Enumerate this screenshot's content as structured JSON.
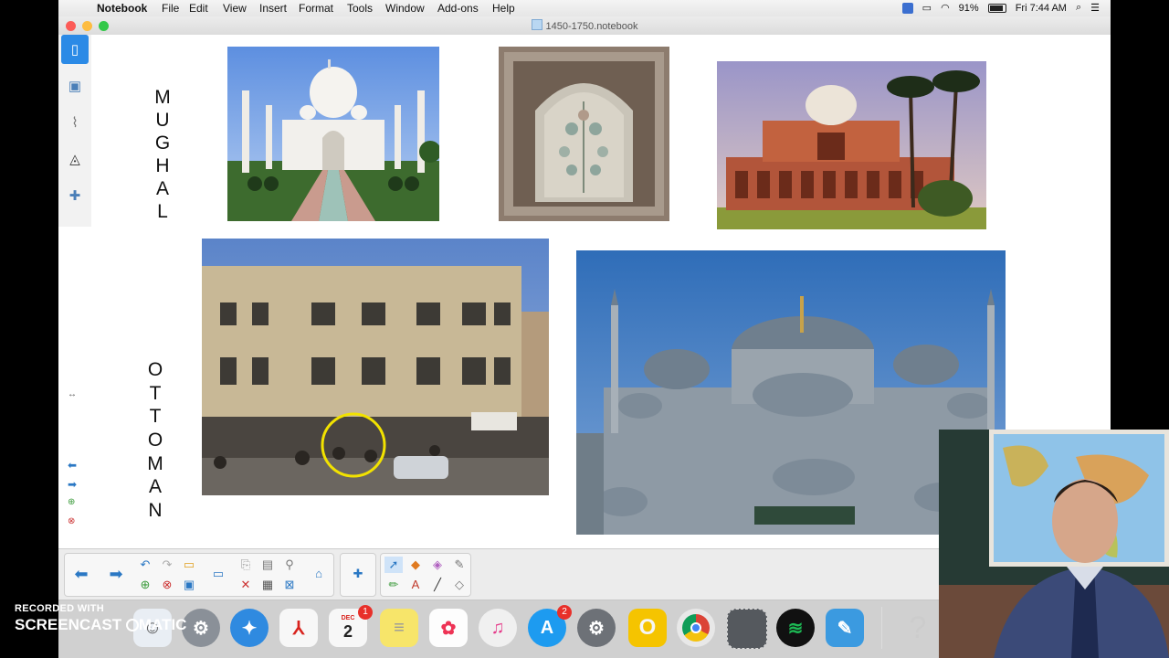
{
  "menubar": {
    "app_name": "Notebook",
    "menus": [
      "File",
      "Edit",
      "View",
      "Insert",
      "Format",
      "Tools",
      "Window",
      "Add-ons",
      "Help"
    ],
    "battery": "91%",
    "clock": "Fri 7:44 AM"
  },
  "window": {
    "title": "1450-1750.notebook"
  },
  "side_tabs": [
    "page-sorter-icon",
    "gallery-icon",
    "attachments-icon",
    "properties-icon",
    "add-ons-icon"
  ],
  "canvas": {
    "mughal_letters": [
      "M",
      "U",
      "G",
      "H",
      "A",
      "L"
    ],
    "ottoman_letters": [
      "O",
      "T",
      "T",
      "O",
      "M",
      "A",
      "N"
    ],
    "images": [
      {
        "name": "taj-mahal-photo",
        "description_icon": "taj-mahal"
      },
      {
        "name": "carved-panel-photo",
        "description_icon": "carved-panel"
      },
      {
        "name": "humayun-tomb-photo",
        "description_icon": "red-sandstone-tomb"
      },
      {
        "name": "ottoman-building-photo",
        "description_icon": "street-building"
      },
      {
        "name": "blue-mosque-photo",
        "description_icon": "mosque"
      }
    ]
  },
  "dock": {
    "calendar_month": "DEC",
    "calendar_day": "2",
    "calendar_badge": "1",
    "appstore_badge": "2"
  },
  "watermark": {
    "line1": "RECORDED WITH",
    "line2a": "SCREENCAST",
    "line2b": "MATIC"
  },
  "colors": {
    "accent": "#2b8ae6",
    "highlight_circle": "#f2e200"
  }
}
